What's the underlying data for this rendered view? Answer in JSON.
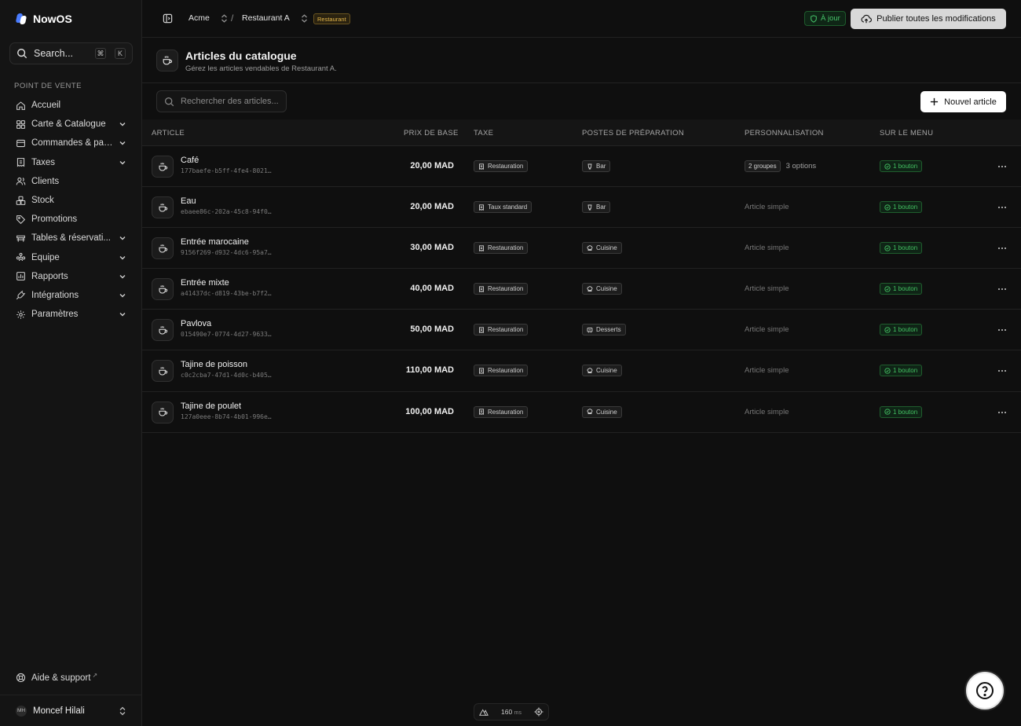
{
  "app": {
    "name": "NowOS"
  },
  "search": {
    "label": "Search...",
    "kbd": [
      "⌘",
      "K"
    ]
  },
  "sidebar": {
    "section_label": "POINT DE VENTE",
    "items": [
      {
        "label": "Accueil",
        "icon": "home-icon",
        "expandable": false
      },
      {
        "label": "Carte & Catalogue",
        "icon": "grid-icon",
        "expandable": true
      },
      {
        "label": "Commandes & pai...",
        "icon": "receipt-icon",
        "expandable": true
      },
      {
        "label": "Taxes",
        "icon": "tax-icon",
        "expandable": true
      },
      {
        "label": "Clients",
        "icon": "users-icon",
        "expandable": false
      },
      {
        "label": "Stock",
        "icon": "boxes-icon",
        "expandable": false
      },
      {
        "label": "Promotions",
        "icon": "tag-icon",
        "expandable": false
      },
      {
        "label": "Tables & réservati...",
        "icon": "table-icon",
        "expandable": true
      },
      {
        "label": "Équipe",
        "icon": "team-icon",
        "expandable": true
      },
      {
        "label": "Rapports",
        "icon": "chart-icon",
        "expandable": true
      },
      {
        "label": "Intégrations",
        "icon": "plug-icon",
        "expandable": true
      },
      {
        "label": "Paramètres",
        "icon": "gear-icon",
        "expandable": true
      }
    ],
    "help": "Aide & support",
    "user": {
      "initials": "MH",
      "name": "Moncef Hilali"
    }
  },
  "topbar": {
    "org": "Acme",
    "location": "Restaurant A",
    "location_badge": "Restaurant",
    "status": "À jour",
    "publish": "Publier toutes les modifications"
  },
  "page": {
    "title": "Articles du catalogue",
    "subtitle": "Gérez les articles vendables de Restaurant A.",
    "search_placeholder": "Rechercher des articles...",
    "new_button": "Nouvel article"
  },
  "table": {
    "headers": {
      "article": "ARTICLE",
      "price": "PRIX DE BASE",
      "tax": "TAXE",
      "stations": "POSTES DE PRÉPARATION",
      "perso": "PERSONNALISATION",
      "menu": "SUR LE MENU"
    },
    "rows": [
      {
        "name": "Café",
        "id": "177baefe-b5ff-4fe4-8021…",
        "price": "20,00 MAD",
        "tax": "Restauration",
        "station": "Bar",
        "station_icon": "bar-icon",
        "groups": "2 groupes",
        "options": "3 options",
        "simple": "",
        "menu": "1 bouton"
      },
      {
        "name": "Eau",
        "id": "ebaee86c-202a-45c8-94f0…",
        "price": "20,00 MAD",
        "tax": "Taux standard",
        "station": "Bar",
        "station_icon": "bar-icon",
        "groups": "",
        "options": "",
        "simple": "Article simple",
        "menu": "1 bouton"
      },
      {
        "name": "Entrée marocaine",
        "id": "9156f269-d932-4dc6-95a7…",
        "price": "30,00 MAD",
        "tax": "Restauration",
        "station": "Cuisine",
        "station_icon": "chef-icon",
        "groups": "",
        "options": "",
        "simple": "Article simple",
        "menu": "1 bouton"
      },
      {
        "name": "Entrée mixte",
        "id": "a41437dc-d819-43be-b7f2…",
        "price": "40,00 MAD",
        "tax": "Restauration",
        "station": "Cuisine",
        "station_icon": "chef-icon",
        "groups": "",
        "options": "",
        "simple": "Article simple",
        "menu": "1 bouton"
      },
      {
        "name": "Pavlova",
        "id": "015490e7-0774-4d27-9633…",
        "price": "50,00 MAD",
        "tax": "Restauration",
        "station": "Desserts",
        "station_icon": "dessert-icon",
        "groups": "",
        "options": "",
        "simple": "Article simple",
        "menu": "1 bouton"
      },
      {
        "name": "Tajine de poisson",
        "id": "c0c2cba7-47d1-4d0c-b405…",
        "price": "110,00 MAD",
        "tax": "Restauration",
        "station": "Cuisine",
        "station_icon": "chef-icon",
        "groups": "",
        "options": "",
        "simple": "Article simple",
        "menu": "1 bouton"
      },
      {
        "name": "Tajine de poulet",
        "id": "127a0eee-8b74-4b01-996e…",
        "price": "100,00 MAD",
        "tax": "Restauration",
        "station": "Cuisine",
        "station_icon": "chef-icon",
        "groups": "",
        "options": "",
        "simple": "Article simple",
        "menu": "1 bouton"
      }
    ]
  },
  "devbar": {
    "value": "160",
    "unit": "ms"
  },
  "colors": {
    "accent_green": "#43c162",
    "badge_amber": "#e3b64a",
    "background": "#0f0f0f"
  }
}
